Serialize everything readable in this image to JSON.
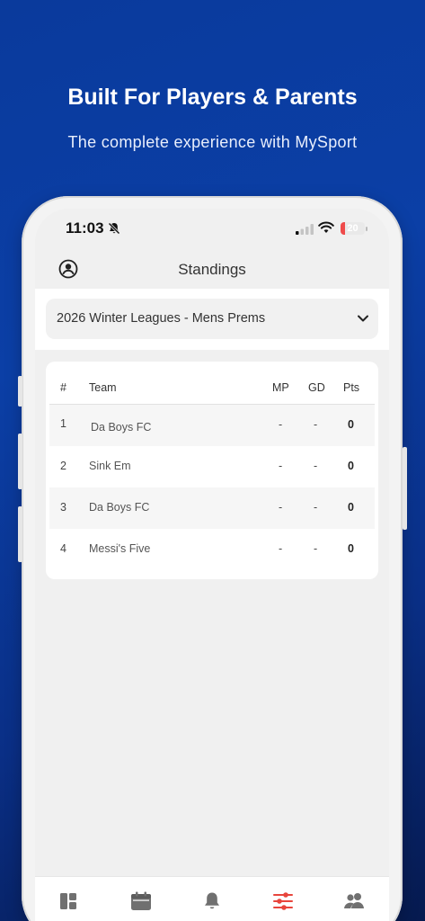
{
  "hero": {
    "title": "Built For Players & Parents",
    "subtitle": "The complete experience with MySport"
  },
  "status_bar": {
    "time": "11:03",
    "battery": "20",
    "battery_level": 0.2
  },
  "header": {
    "title": "Standings",
    "left_icon": "user-circle-icon"
  },
  "league_selector": {
    "value": "2026 Winter Leagues - Mens Prems",
    "icon": "chevron-down-icon"
  },
  "table": {
    "headers": {
      "rank": "#",
      "team": "Team",
      "mp": "MP",
      "gd": "GD",
      "pts": "Pts"
    },
    "rows": [
      {
        "rank": "1",
        "team": "Da Boys FC",
        "mp": "-",
        "gd": "-",
        "pts": "0"
      },
      {
        "rank": "2",
        "team": "Sink Em",
        "mp": "-",
        "gd": "-",
        "pts": "0"
      },
      {
        "rank": "3",
        "team": "Da Boys FC",
        "mp": "-",
        "gd": "-",
        "pts": "0"
      },
      {
        "rank": "4",
        "team": "Messi's Five",
        "mp": "-",
        "gd": "-",
        "pts": "0"
      }
    ]
  },
  "tabs": [
    {
      "icon": "dashboard-icon",
      "active": false
    },
    {
      "icon": "calendar-icon",
      "active": false
    },
    {
      "icon": "bell-icon",
      "active": false
    },
    {
      "icon": "sliders-icon",
      "active": true
    },
    {
      "icon": "users-icon",
      "active": false
    }
  ],
  "colors": {
    "accent": "#e8453c",
    "background_blue": "#0b3fa6",
    "icon_gray": "#707070"
  }
}
